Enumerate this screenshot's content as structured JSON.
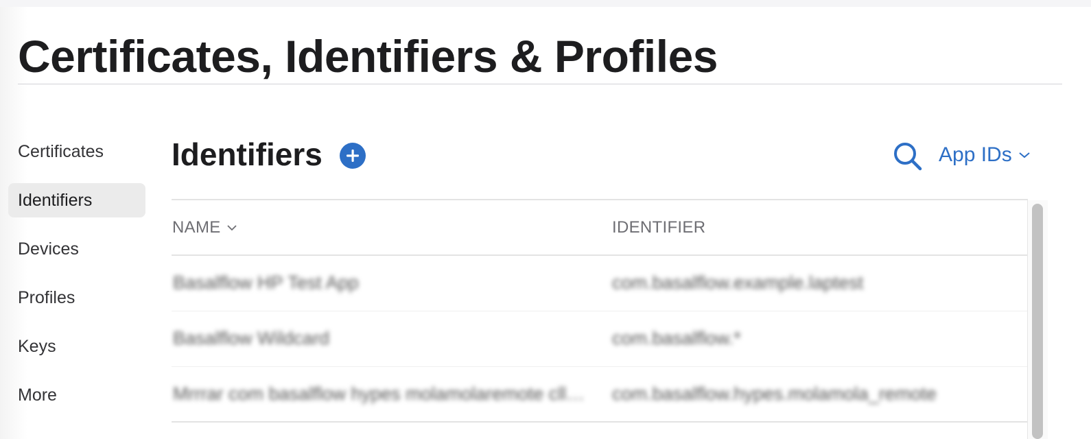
{
  "header": {
    "title": "Certificates, Identifiers & Profiles"
  },
  "sidebar": {
    "items": [
      {
        "label": "Certificates"
      },
      {
        "label": "Identifiers"
      },
      {
        "label": "Devices"
      },
      {
        "label": "Profiles"
      },
      {
        "label": "Keys"
      },
      {
        "label": "More"
      }
    ],
    "active": "Identifiers"
  },
  "main": {
    "section_title": "Identifiers",
    "add_icon": "plus-circle-icon",
    "search_icon": "search-icon",
    "filter_label": "App IDs",
    "table": {
      "columns": [
        "NAME",
        "IDENTIFIER"
      ],
      "rows": [
        {
          "name": "Basalflow HP Test App",
          "identifier": "com.basalflow.example.laptest"
        },
        {
          "name": "Basalflow Wildcard",
          "identifier": "com.basalflow.*"
        },
        {
          "name": "Mrrrar com basalflow hypes molamolaremote clla...",
          "identifier": "com.basalflow.hypes.molamola_remote"
        }
      ]
    }
  },
  "colors": {
    "accent": "#2d6fc6",
    "active_bg": "#ebebeb"
  }
}
